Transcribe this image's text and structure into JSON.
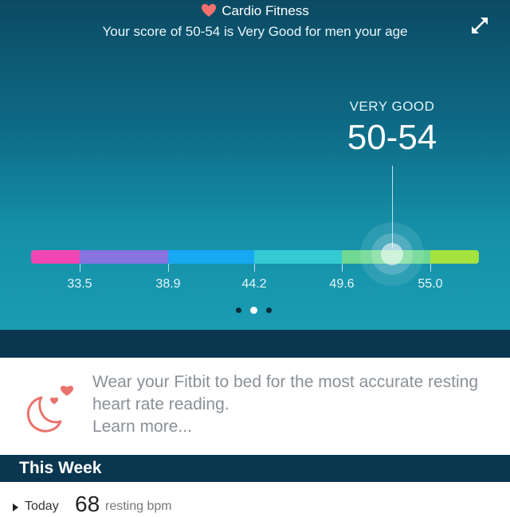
{
  "header": {
    "title": "Cardio Fitness",
    "subtitle": "Your score of 50-54 is Very Good for men your age",
    "heart_icon": "heart-icon",
    "expand_icon": "expand-icon"
  },
  "score": {
    "level": "VERY GOOD",
    "value": "50-54"
  },
  "scale": {
    "ticks": [
      "33.5",
      "38.9",
      "44.2",
      "49.6",
      "55.0"
    ],
    "segment_colors": [
      "#f046b4",
      "#8673e0",
      "#17a8f2",
      "#33cad4",
      "#6fd892",
      "#a4e33e"
    ]
  },
  "pager": {
    "count": 3,
    "active_index": 1
  },
  "tip": {
    "text": "Wear your Fitbit to bed for the most accurate resting heart rate reading.",
    "link": "Learn more...",
    "icon": "moon-hearts-icon",
    "accent_color": "#e8736c"
  },
  "week": {
    "title": "This Week",
    "rows": [
      {
        "day": "Today",
        "value": "68",
        "unit": "resting bpm"
      }
    ]
  }
}
